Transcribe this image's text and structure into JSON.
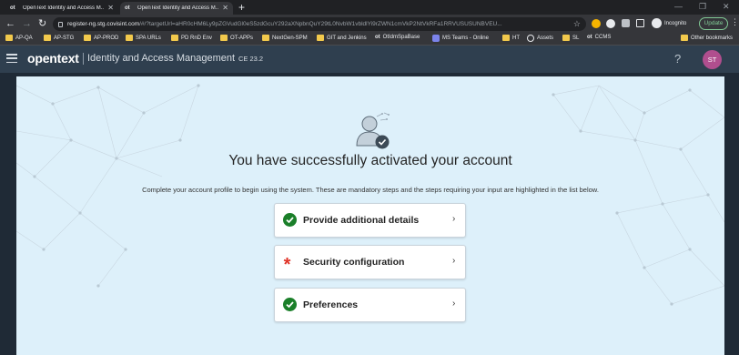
{
  "browser": {
    "tabs": [
      {
        "favicon": "ot",
        "title": "OpenText Identity and Access M..."
      },
      {
        "favicon": "ot",
        "title": "OpenText Identity and Access M..."
      }
    ],
    "new_tab_label": "+",
    "url_host": "register-ng.stg.covisint.com",
    "url_path": "/#/?targetUrl=aHR0cHM6Ly9pZGVudGl0eS5zdGcuY292aXNpbnQuY29tL0NvbW1vbldlYi9rZWN1cmVkP2NtVkRFa1RRVUSUSUNBVEU...",
    "incognito_label": "Incognito",
    "update_label": "Update",
    "bookmarks": [
      {
        "icon": "folder-icon",
        "label": "AP-QA"
      },
      {
        "icon": "folder-icon",
        "label": "AP-STG"
      },
      {
        "icon": "folder-icon",
        "label": "AP-PROD"
      },
      {
        "icon": "folder-icon",
        "label": "SPA URLs"
      },
      {
        "icon": "folder-icon",
        "label": "PD RnD Env"
      },
      {
        "icon": "folder-icon",
        "label": "OT-APPs"
      },
      {
        "icon": "folder-icon",
        "label": "NextGen-SPM"
      },
      {
        "icon": "folder-icon",
        "label": "GIT and Jenkins"
      },
      {
        "icon": "ot-icon",
        "label": "OtIdmSpaBase"
      },
      {
        "icon": "teams-icon",
        "label": "MS Teams - Online"
      },
      {
        "icon": "folder-icon",
        "label": "HT"
      },
      {
        "icon": "globe-icon",
        "label": "Assets"
      },
      {
        "icon": "folder-icon",
        "label": "SL"
      },
      {
        "icon": "ot-icon",
        "label": "CCMS"
      },
      {
        "icon": "folder-icon",
        "label": "Other bookmarks"
      }
    ]
  },
  "app": {
    "logo": "opentext",
    "name": "Identity and Access Management",
    "version": "CE 23.2",
    "help_label": "?",
    "avatar_initials": "ST",
    "avatar_color": "#b04e8e"
  },
  "main": {
    "title": "You have successfully activated your account",
    "subtitle": "Complete your account profile to begin using the system. These are mandatory steps and the steps requiring your input are highlighted in the list below.",
    "steps": [
      {
        "label": "Provide additional details",
        "status": "complete",
        "icon": "check-circle-icon"
      },
      {
        "label": "Security configuration",
        "status": "required",
        "icon": "required-asterisk-icon",
        "marker": "*"
      },
      {
        "label": "Preferences",
        "status": "complete",
        "icon": "check-circle-icon"
      }
    ]
  },
  "colors": {
    "header_bg": "#2f3f4f",
    "card_bg": "#ddf0fa",
    "complete_green": "#1a7f29",
    "required_red": "#e03327"
  }
}
